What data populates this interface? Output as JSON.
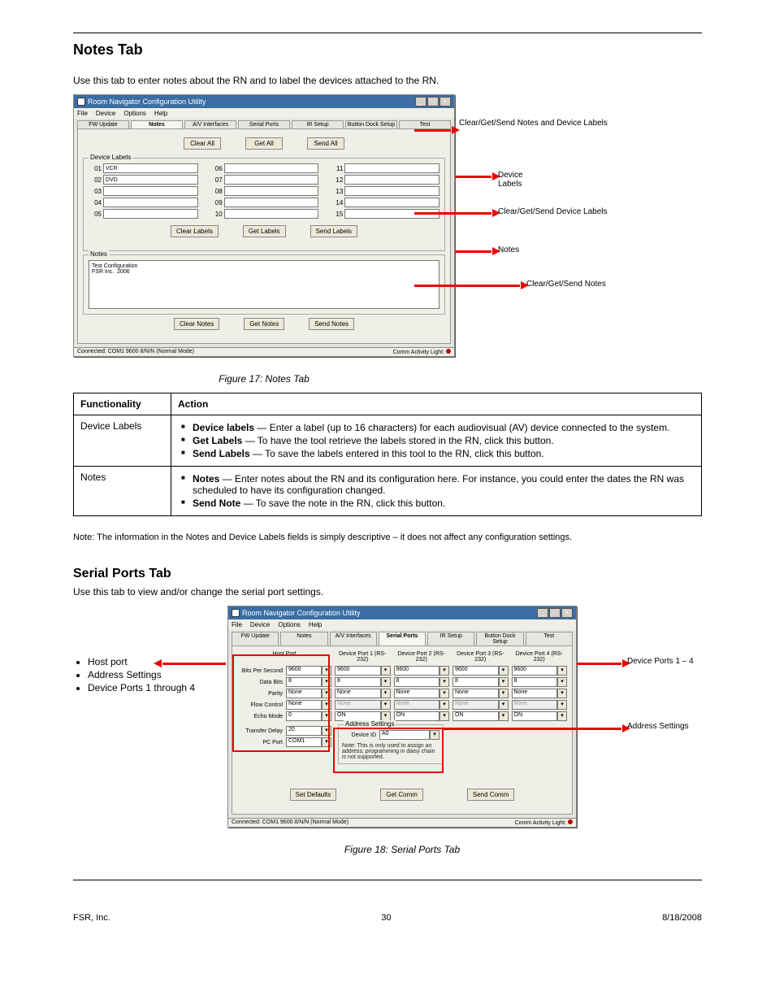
{
  "header": {
    "title": "Notes Tab",
    "subsection": "Serial Ports Tab"
  },
  "intro": "Use this tab to enter notes about the RN and to label the devices attached to the RN.",
  "figure1": {
    "windowTitle": "Room Navigator Configuration Utility",
    "menu": [
      "File",
      "Device",
      "Options",
      "Help"
    ],
    "tabs": [
      "FW Update",
      "Notes",
      "A/V Interfaces",
      "Serial Ports",
      "IR Setup",
      "Button Dock Setup",
      "Test"
    ],
    "activeTab": "Notes",
    "topButtons": [
      "Clear All",
      "Get All",
      "Send All"
    ],
    "deviceLabelsTitle": "Device Labels",
    "devices": [
      {
        "n": "01",
        "v": "VCR"
      },
      {
        "n": "02",
        "v": "DVD"
      },
      {
        "n": "03",
        "v": ""
      },
      {
        "n": "04",
        "v": ""
      },
      {
        "n": "05",
        "v": ""
      },
      {
        "n": "06",
        "v": ""
      },
      {
        "n": "07",
        "v": ""
      },
      {
        "n": "08",
        "v": ""
      },
      {
        "n": "09",
        "v": ""
      },
      {
        "n": "10",
        "v": ""
      },
      {
        "n": "11",
        "v": ""
      },
      {
        "n": "12",
        "v": ""
      },
      {
        "n": "13",
        "v": ""
      },
      {
        "n": "14",
        "v": ""
      },
      {
        "n": "15",
        "v": ""
      }
    ],
    "devButtons": [
      "Clear Labels",
      "Get Labels",
      "Send Labels"
    ],
    "notesTitle": "Notes",
    "notesText": "Test Configuration\nFSR Inc.  2006",
    "noteButtons": [
      "Clear Notes",
      "Get Notes",
      "Send Notes"
    ],
    "status": "Connected: COM1 9600 8/N/N (Normal Mode)",
    "activityLabel": "Comm Activity Light:",
    "caption": "Figure 17: Notes Tab",
    "callouts": {
      "topButtonsLabel": "Clear/Get/Send Notes and Device Labels",
      "devGridLabel": "Device Labels",
      "devButtonsLabel": "Clear/Get/Send Device Labels",
      "notesAreaLabel": "Notes",
      "noteButtonsLabel": "Clear/Get/Send Notes"
    }
  },
  "table": {
    "cols": [
      "Functionality",
      "Action"
    ],
    "rows": [
      {
        "func": "Device Labels",
        "actions": [
          "<b>Device labels</b> — Enter a label (up to 16 characters) for each audiovisual (AV) device connected to the system.",
          "<b>Get Labels</b> — To have the tool retrieve the labels stored in the RN, click this button.",
          "<b>Send Labels</b> — To save the labels entered in this tool to the RN, click this button."
        ]
      },
      {
        "func": "Notes",
        "actions": [
          "<b>Notes</b> — Enter notes about the RN and its configuration here. For instance, you could enter the dates the RN was scheduled to have its configuration changed.",
          "<b>Send Note</b> — To save the note in the RN, click this button."
        ]
      }
    ]
  },
  "finePrint": "Note: The information in the Notes and Device Labels fields is simply descriptive – it does not affect any configuration settings.",
  "serialIntro": "Use this tab to view and/or change the serial port settings.",
  "serialBullets": [
    "Host port",
    "Address Settings",
    "Device Ports 1 through 4"
  ],
  "figure2": {
    "windowTitle": "Room Navigator Configuration Utility",
    "menu": [
      "File",
      "Device",
      "Options",
      "Help"
    ],
    "tabs": [
      "FW Update",
      "Notes",
      "A/V Interfaces",
      "Serial Ports",
      "IR Setup",
      "Button Dock Setup",
      "Test"
    ],
    "activeTab": "Serial Ports",
    "cols": [
      "Host Port",
      "Device Port 1 (RS-232)",
      "Device Port 2 (RS-232)",
      "Device Port 3 (RS-232)",
      "Device Port 4 (RS-232)"
    ],
    "rows": [
      {
        "label": "Bits Per Second",
        "host": "9600",
        "d": [
          "9600",
          "9600",
          "9600",
          "9600"
        ]
      },
      {
        "label": "Data Bits",
        "host": "8",
        "d": [
          "8",
          "8",
          "8",
          "8"
        ]
      },
      {
        "label": "Parity",
        "host": "None",
        "d": [
          "None",
          "None",
          "None",
          "None"
        ]
      },
      {
        "label": "Flow Control",
        "host": "None",
        "d": [
          "None",
          "None",
          "None",
          "None"
        ],
        "disabled": true
      },
      {
        "label": "Echo Mode",
        "host": "0",
        "d": [
          "ON",
          "ON",
          "ON",
          "ON"
        ]
      }
    ],
    "extraHost": [
      {
        "label": "Transfer Delay",
        "val": "20"
      },
      {
        "label": "PC Port",
        "val": "COM1"
      }
    ],
    "addrTitle": "Address Settings",
    "addrLabel": "Device ID",
    "addrVal": "A0",
    "addrNote": "Note: This is only used to assign an address; programming in daisy chain is not supported.",
    "bottomButtons": [
      "Set Defaults",
      "Get Comm",
      "Send Comm"
    ],
    "status": "Connected: COM1 9600 8/N/N (Normal Mode)",
    "activityLabel": "Comm Activity Light:",
    "caption": "Figure 18: Serial Ports Tab",
    "callouts": {
      "hostLabel": "Host Port",
      "deviceLabel": "Device Ports 1 – 4",
      "addrLabel": "Address Settings"
    }
  },
  "footer": {
    "left": "FSR, Inc.",
    "center": "30",
    "right": "8/18/2008"
  }
}
